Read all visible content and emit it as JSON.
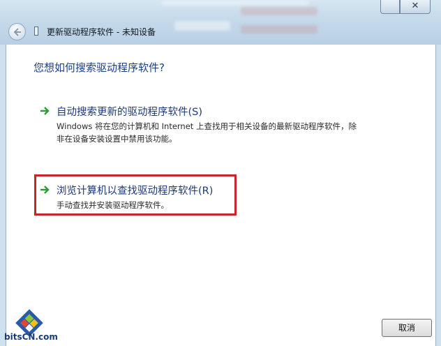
{
  "window": {
    "title": "更新驱动程序软件 - 未知设备",
    "close_glyph": "✕"
  },
  "main": {
    "heading": "您想如何搜索驱动程序软件?",
    "options": [
      {
        "title": "自动搜索更新的驱动程序软件(S)",
        "description": "Windows 将在您的计算机和 Internet 上查找用于相关设备的最新驱动程序软件，除非在设备安装设置中禁用该功能。",
        "icon": "green-arrow-icon"
      },
      {
        "title": "浏览计算机以查找驱动程序软件(R)",
        "description": "手动查找并安装驱动程序软件。",
        "icon": "green-arrow-icon"
      }
    ]
  },
  "footer": {
    "cancel_label": "取消"
  },
  "branding": {
    "logo_text": "bitsCN.com"
  },
  "colors": {
    "heading": "#1b3f8b",
    "arrow": "#2f9b3a",
    "highlight": "#c8242b"
  }
}
